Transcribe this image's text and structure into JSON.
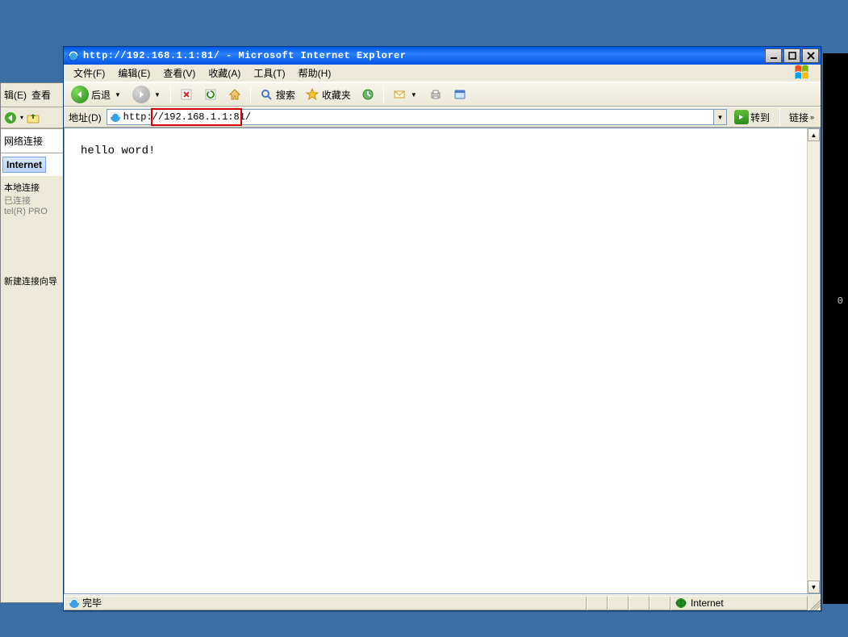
{
  "desktop": {
    "bg_black_text": "0"
  },
  "bg_window": {
    "toolbar_partial": "辑(E)",
    "toolbar_view": "查看",
    "section_header": "网络连接",
    "selected_item": "Internet",
    "lan_label": "本地连接",
    "lan_status": "已连接",
    "lan_adapter": "tel(R) PRO",
    "wizard_label": "新建连接向导"
  },
  "ie": {
    "title": "http://192.168.1.1:81/ - Microsoft Internet Explorer",
    "menu": {
      "file": "文件(F)",
      "edit": "编辑(E)",
      "view": "查看(V)",
      "favorites": "收藏(A)",
      "tools": "工具(T)",
      "help": "帮助(H)"
    },
    "toolbar": {
      "back": "后退",
      "search": "搜索",
      "favorites": "收藏夹"
    },
    "address": {
      "label": "地址(D)",
      "value": "http://192.168.1.1:81/",
      "go": "转到",
      "links": "链接"
    },
    "page": {
      "body_text": "hello word!"
    },
    "status": {
      "done": "完毕",
      "zone": "Internet"
    }
  }
}
